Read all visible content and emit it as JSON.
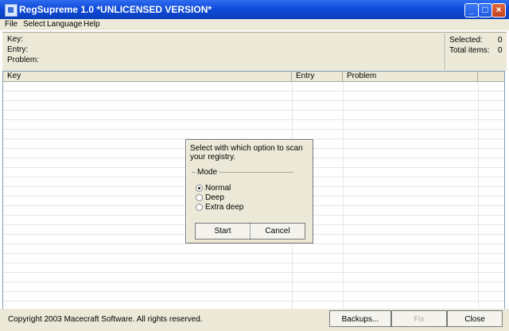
{
  "window": {
    "title": "RegSupreme 1.0  *UNLICENSED VERSION*"
  },
  "menu": [
    "File",
    "Select",
    "Language",
    "Help"
  ],
  "info": {
    "key_label": "Key:",
    "entry_label": "Entry:",
    "problem_label": "Problem:",
    "selected_label": "Selected:",
    "selected_value": "0",
    "total_label": "Total items:",
    "total_value": "0"
  },
  "table": {
    "columns": [
      "Key",
      "Entry",
      "Problem"
    ]
  },
  "dialog": {
    "message": "Select with which option to scan your registry.",
    "group_label": "Mode",
    "options": [
      "Normal",
      "Deep",
      "Extra deep"
    ],
    "selected_option": "Normal",
    "start_label": "Start",
    "cancel_label": "Cancel"
  },
  "status": {
    "copyright": "Copyright 2003 Macecraft Software. All rights reserved.",
    "backups_label": "Backups...",
    "fix_label": "Fix",
    "close_label": "Close"
  }
}
